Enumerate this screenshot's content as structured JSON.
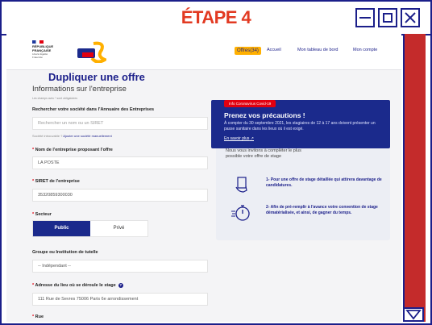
{
  "window": {
    "step_title": "ÉTAPE 4"
  },
  "header": {
    "republique": "RÉPUBLIQUE FRANÇAISE",
    "motto": "Liberté Égalité Fraternité",
    "logo_text_1": "mon",
    "logo_text_2": "stage",
    "logo_text_3": "de",
    "offres_badge": "Offres(34)",
    "nav": [
      "Accueil",
      "Mon tableau de bord",
      "Mon compte"
    ]
  },
  "form": {
    "title": "Dupliquer une offre",
    "section": "Informations sur l'entreprise",
    "required_note": "Les champs avec * sont obligatoires",
    "search_label": "Rechercher votre société dans l'Annuaire des Entreprises",
    "search_placeholder": "Rechercher un nom ou un SIRET",
    "not_found_text": "Société introuvable ?",
    "add_manual_link": "Ajouter une société manuellement",
    "company_name_label": "Nom de l'entreprise proposant l'offre",
    "company_name_value": "LA POSTE",
    "siret_label": "SIRET de l'entreprise",
    "siret_value": "35320859300030",
    "sector_label": "Secteur",
    "sector_public": "Public",
    "sector_private": "Privé",
    "group_label": "Groupe ou Institution de tutelle",
    "group_value": "-- Indépendant --",
    "address_label": "Adresse du lieu où se déroule le stage",
    "address_value": "111 Rue de Sevres 75006 Paris 6e arrondissement",
    "street_label": "Rue"
  },
  "covid": {
    "tag": "Info Coronavirus Covid-19",
    "title": "Prenez vos précautions !",
    "body": "À compter du 30 septembre 2021, les stagiaires de 12 à 17 ans doivent présenter un passe sanitaire dans les lieux où il est exigé.",
    "link": "En savoir plus"
  },
  "sidebar": {
    "invite": "Nous vous invitons à compléter le plus possible votre offre de stage",
    "tip1": "1- Pour une offre de stage détaillée qui attirera davantage de candidatures.",
    "tip2": "2- Afin de pré-remplir à l'avance votre convention de stage dématérialisée, et ainsi, de gagner du temps."
  },
  "colors": {
    "brand_blue": "#1b2a8c",
    "accent_red": "#e1000f",
    "step_red": "#e23a22",
    "scroll_red": "#c42b2b",
    "badge_yellow": "#ffb000"
  }
}
